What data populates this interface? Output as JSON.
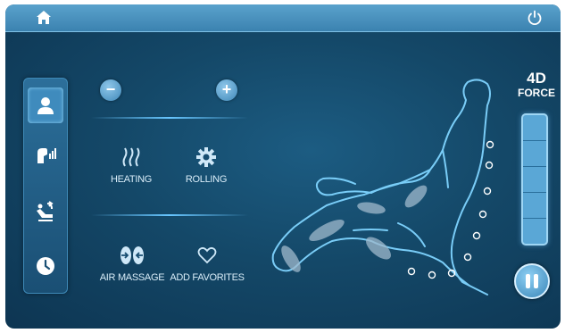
{
  "topbar": {
    "home_icon": "home-icon",
    "power_icon": "power-icon"
  },
  "sidebar": {
    "items": [
      {
        "icon": "user-icon",
        "active": true
      },
      {
        "icon": "body-intensity-icon",
        "active": false
      },
      {
        "icon": "recline-chair-icon",
        "active": false
      },
      {
        "icon": "clock-icon",
        "active": false
      }
    ]
  },
  "controls": {
    "minus_label": "−",
    "plus_label": "+"
  },
  "features": [
    {
      "label": "HEATING",
      "icon": "heat-waves-icon"
    },
    {
      "label": "ROLLING",
      "icon": "gear-icon"
    },
    {
      "label": "AIR MASSAGE",
      "icon": "air-massage-icon"
    },
    {
      "label": "ADD FAVORITES",
      "icon": "heart-icon"
    }
  ],
  "force": {
    "title_line1": "4D",
    "title_line2": "FORCE",
    "level_fraction": 1.0,
    "segments": 5
  },
  "colors": {
    "accent": "#68c6ff",
    "background": "#144868",
    "topbar": "#4a92c0"
  }
}
